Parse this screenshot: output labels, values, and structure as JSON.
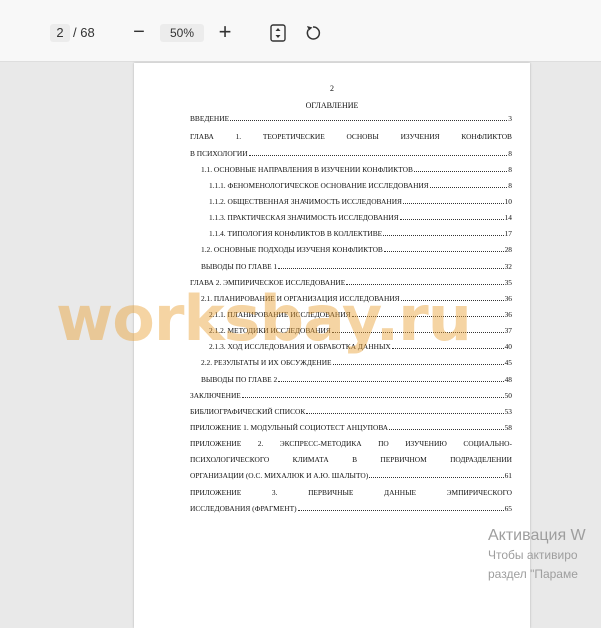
{
  "toolbar": {
    "current_page": "2",
    "total_pages": "/ 68",
    "zoom_out": "−",
    "zoom_level": "50%",
    "zoom_in": "+",
    "fit_icon": "fit-page-icon",
    "rotate_icon": "rotate-icon"
  },
  "page": {
    "number": "2",
    "heading": "ОГЛАВЛЕНИЕ",
    "toc": [
      {
        "title": "ВВЕДЕНИЕ",
        "page": "3"
      },
      {
        "title": "ГЛАВА 1. ТЕОРЕТИЧЕСКИЕ ОСНОВЫ ИЗУЧЕНИЯ КОНФЛИКТОВ"
      },
      {
        "title": "В ПСИХОЛОГИИ",
        "page": "8"
      },
      {
        "title": "1.1. ОСНОВНЫЕ НАПРАВЛЕНИЯ В ИЗУЧЕНИИ КОНФЛИКТОВ",
        "page": "8"
      },
      {
        "title": "1.1.1. ФЕНОМЕНОЛОГИЧЕСКОЕ ОСНОВАНИЕ ИССЛЕДОВАНИЯ",
        "page": "8"
      },
      {
        "title": "1.1.2. ОБЩЕСТВЕННАЯ ЗНАЧИМОСТЬ ИССЛЕДОВАНИЯ",
        "page": "10"
      },
      {
        "title": "1.1.3. ПРАКТИЧЕСКАЯ ЗНАЧИМОСТЬ ИССЛЕДОВАНИЯ",
        "page": "14"
      },
      {
        "title": "1.1.4. ТИПОЛОГИЯ КОНФЛИКТОВ В КОЛЛЕКТИВЕ",
        "page": "17"
      },
      {
        "title": "1.2. ОСНОВНЫЕ ПОДХОДЫ ИЗУЧЕНЯ КОНФЛИКТОВ",
        "page": "28"
      },
      {
        "title": "ВЫВОДЫ ПО ГЛАВЕ 1",
        "page": "32"
      },
      {
        "title": "ГЛАВА 2. ЭМПИРИЧЕСКОЕ ИССЛЕДОВАНИЕ",
        "page": "35"
      },
      {
        "title": "2.1. ПЛАНИРОВАНИЕ И ОРГАНИЗАЦИЯ ИССЛЕДОВАНИЯ",
        "page": "36"
      },
      {
        "title": "2.1.1. ПЛАНИРОВАНИЕ ИССЛЕДОВАНИЯ",
        "page": "36"
      },
      {
        "title": "2.1.2. МЕТОДИКИ ИССЛЕДОВАНИЯ",
        "page": "37"
      },
      {
        "title": "2.1.3. ХОД ИССЛЕДОВАНИЯ И ОБРАБОТКА ДАННЫХ",
        "page": "40"
      },
      {
        "title": "2.2. РЕЗУЛЬТАТЫ И ИХ ОБСУЖДЕНИЕ",
        "page": "45"
      },
      {
        "title": "ВЫВОДЫ ПО ГЛАВЕ 2",
        "page": "48"
      },
      {
        "title": "ЗАКЛЮЧЕНИЕ",
        "page": "50"
      },
      {
        "title": "БИБЛИОГРАФИЧЕСКИЙ СПИСОК",
        "page": "53"
      },
      {
        "title": "ПРИЛОЖЕНИЕ 1. МОДУЛЬНЫЙ СОЦИОТЕСТ АНЦУПОВА",
        "page": "58"
      },
      {
        "title": "ПРИЛОЖЕНИЕ 2. ЭКСПРЕСС-МЕТОДИКА ПО ИЗУЧЕНИЮ СОЦИАЛЬНО-"
      },
      {
        "title": "ПСИХОЛОГИЧЕСКОГО КЛИМАТА В ПЕРВИЧНОМ ПОДРАЗДЕЛЕНИИ"
      },
      {
        "title": "ОРГАНИЗАЦИИ (О.С. МИХАЛЮК И А.Ю. ШАЛЫТО)",
        "page": "61"
      },
      {
        "title": "ПРИЛОЖЕНИЕ 3. ПЕРВИЧНЫЕ ДАННЫЕ ЭМПИРИЧЕСКОГО"
      },
      {
        "title": "ИССЛЕДОВАНИЯ (ФРАГМЕНТ)",
        "page": "65"
      }
    ]
  },
  "watermark": "worksbay.ru",
  "activation": {
    "title": "Активация W",
    "line1": "Чтобы активиро",
    "line2": "раздел \"Параме"
  }
}
